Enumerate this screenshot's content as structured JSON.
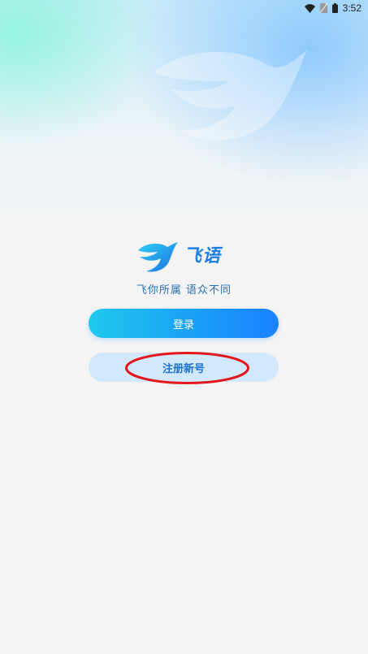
{
  "status_bar": {
    "time": "3:52",
    "icons": [
      "wifi-icon",
      "sim-icon",
      "battery-icon"
    ]
  },
  "logo": {
    "text": "飞语",
    "icon": "bird-logo-icon"
  },
  "slogan": "飞你所属 语众不同",
  "buttons": {
    "login_label": "登录",
    "register_label": "注册新号"
  },
  "colors": {
    "brand_blue": "#1e7fe6",
    "login_gradient_start": "#20c9ee",
    "login_gradient_end": "#1a82ff",
    "register_bg": "#d2e8fb",
    "annotation_red": "#e3161b"
  }
}
